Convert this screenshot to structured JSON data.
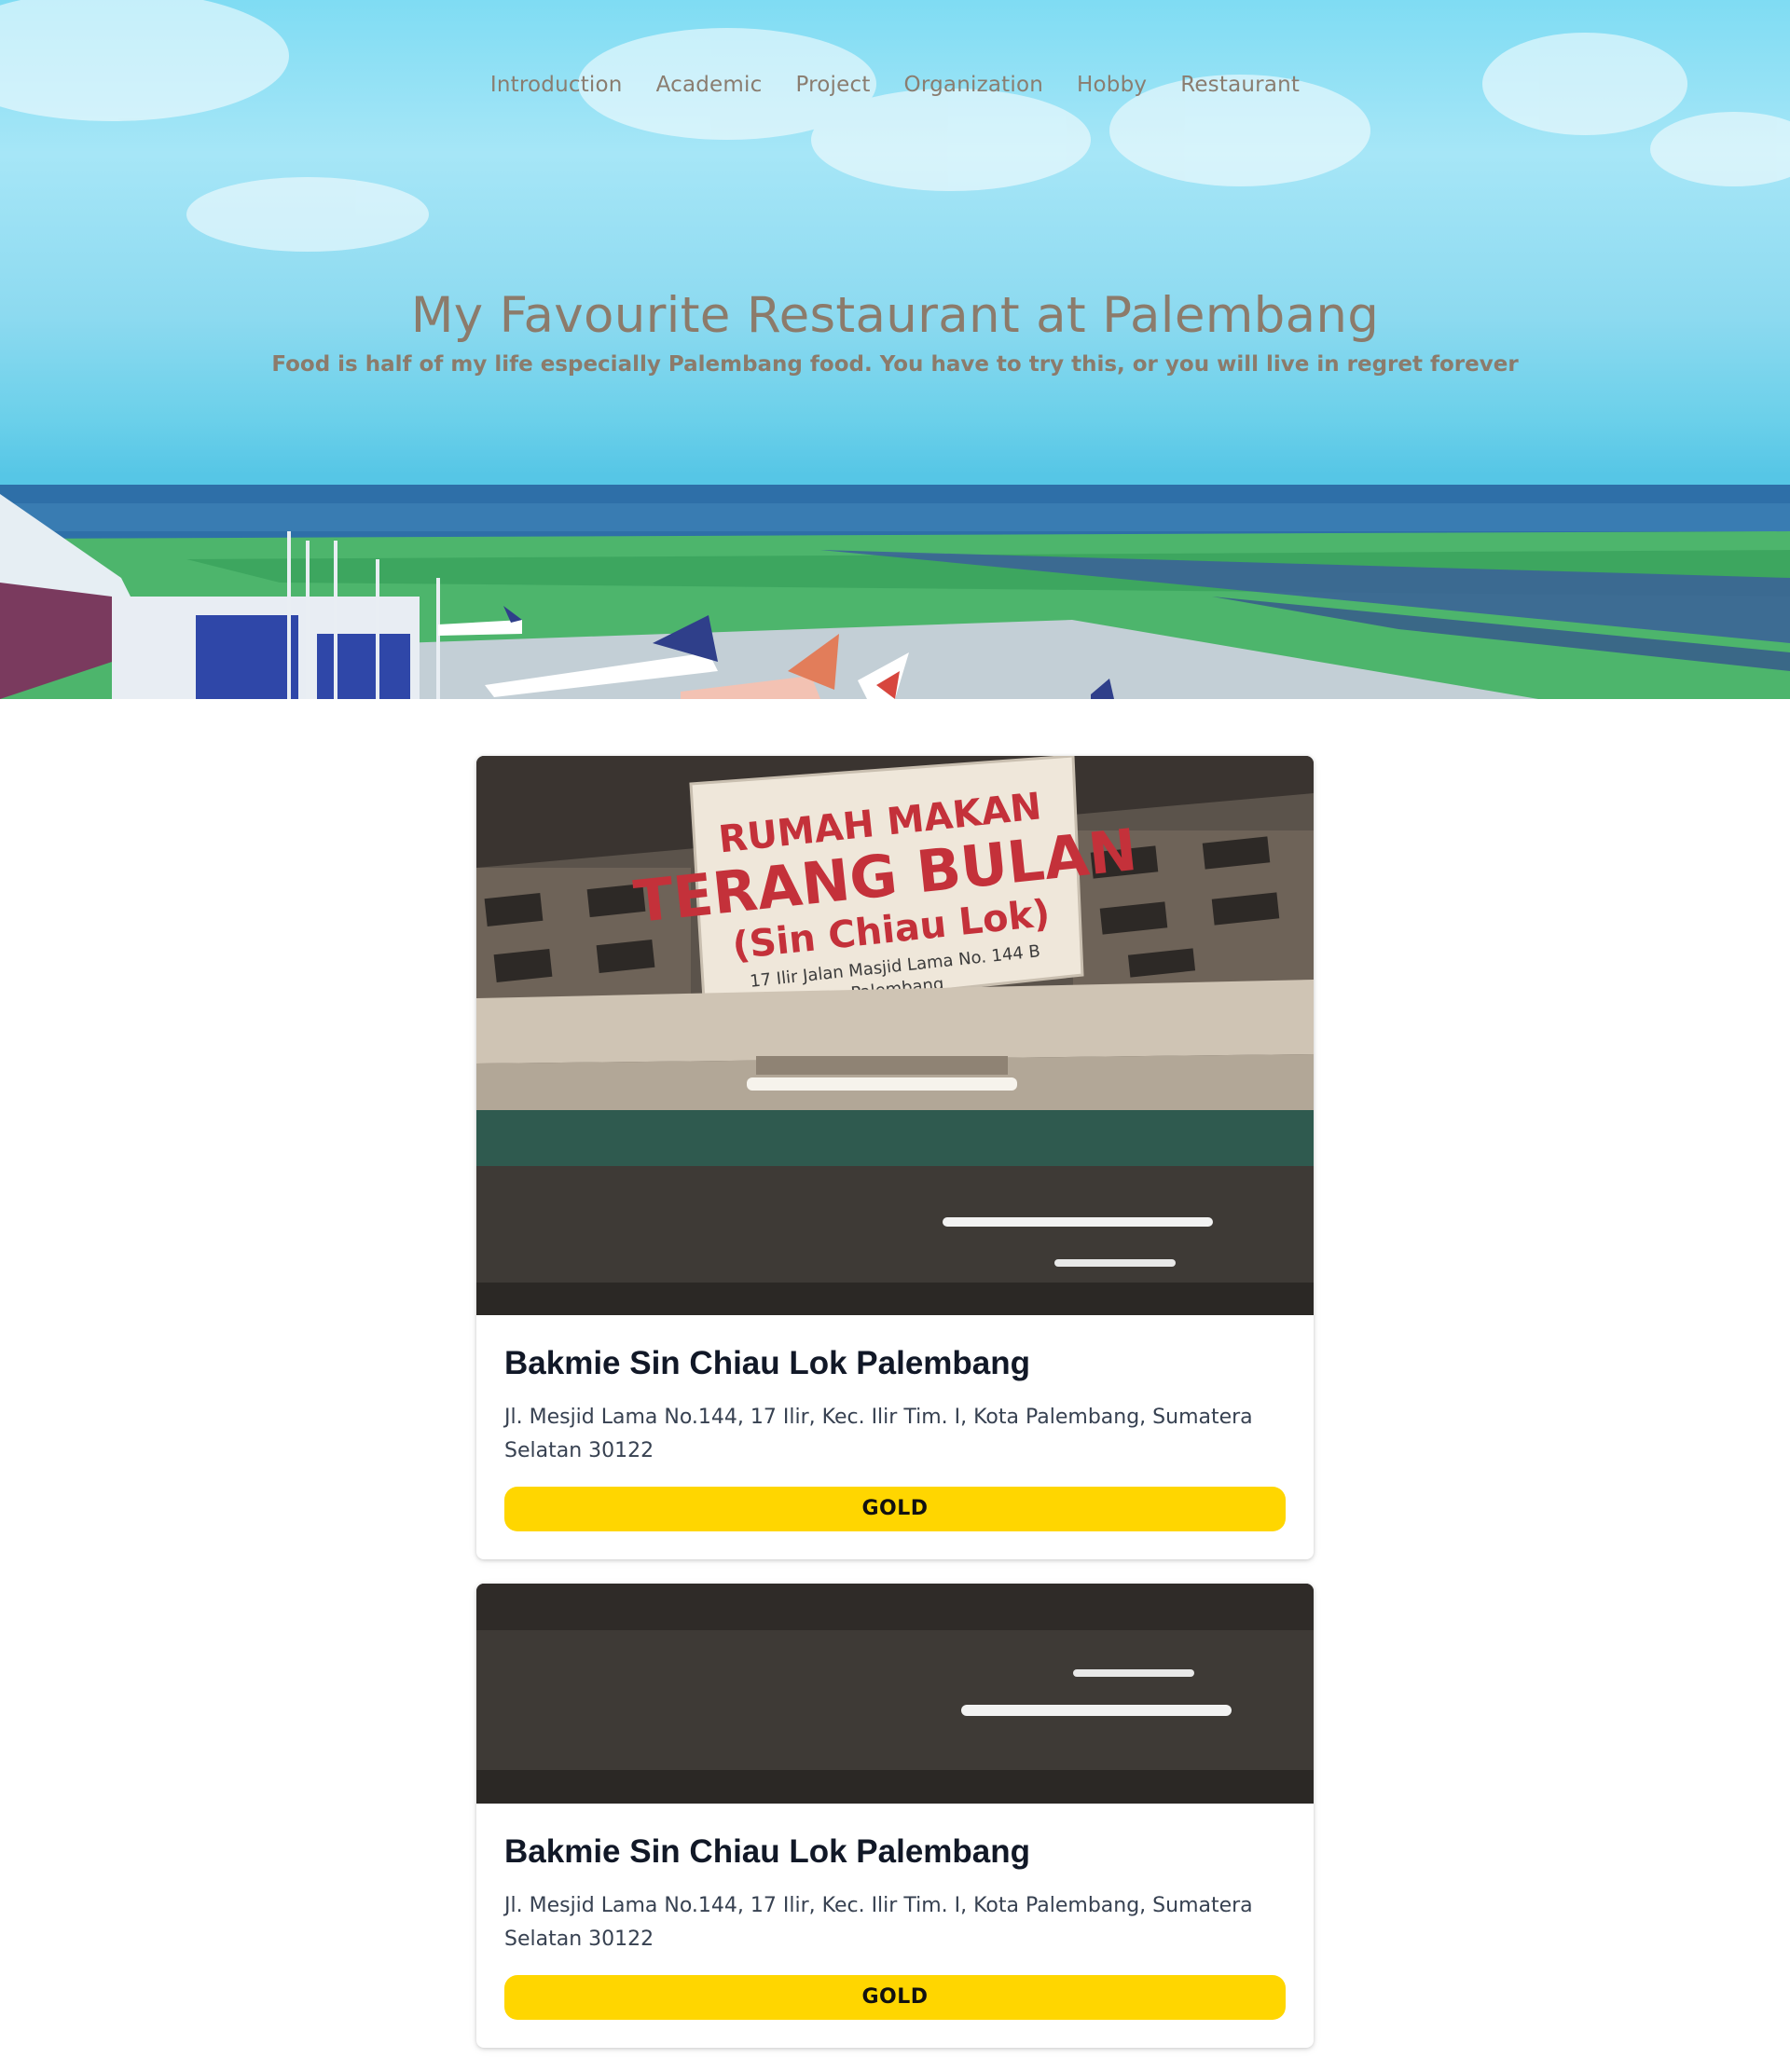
{
  "nav": {
    "items": [
      {
        "label": "Introduction"
      },
      {
        "label": "Academic"
      },
      {
        "label": "Project"
      },
      {
        "label": "Organization"
      },
      {
        "label": "Hobby"
      },
      {
        "label": "Restaurant"
      }
    ]
  },
  "hero": {
    "title": "My Favourite Restaurant at Palembang",
    "subtitle": "Food is half of my life especially Palembang food. You have to try this, or you will live in regret forever"
  },
  "restaurants": [
    {
      "name": "Bakmie Sin Chiau Lok Palembang",
      "address": "Jl. Mesjid Lama No.144, 17 Ilir, Kec. Ilir Tim. I, Kota Palembang, Sumatera Selatan 30122",
      "tier": "GOLD",
      "sign": {
        "line1": "RUMAH MAKAN",
        "line2": "TERANG BULAN",
        "line3": "(Sin Chiau Lok)",
        "line4": "17 Ilir Jalan Masjid Lama No. 144 B",
        "line5": "Palembang"
      }
    },
    {
      "name": "Bakmie Sin Chiau Lok Palembang",
      "address": "Jl. Mesjid Lama No.144, 17 Ilir, Kec. Ilir Tim. I, Kota Palembang, Sumatera Selatan 30122",
      "tier": "GOLD"
    }
  ],
  "colors": {
    "nav_text": "#8a7d70",
    "hero_text": "#8c7b6b",
    "badge_gold": "#ffd600",
    "card_title": "#111827",
    "card_text": "#374151"
  }
}
